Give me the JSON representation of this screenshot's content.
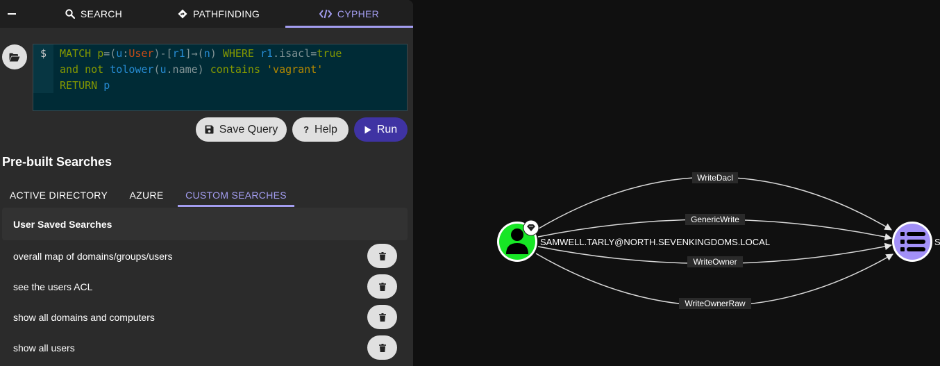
{
  "tabs": [
    {
      "label": "SEARCH",
      "icon": "search-icon",
      "active": false
    },
    {
      "label": "PATHFINDING",
      "icon": "pathfinding-icon",
      "active": false
    },
    {
      "label": "CYPHER",
      "icon": "code-icon",
      "active": true
    }
  ],
  "editor": {
    "prompt": "$",
    "query": "MATCH p=(u:User)-[r1]→(n) WHERE r1.isacl=true and not tolower(u.name) contains 'vagrant' RETURN p"
  },
  "actions": {
    "save_label": "Save Query",
    "help_label": "Help",
    "run_label": "Run",
    "help_glyph": "?"
  },
  "prebuilt": {
    "title": "Pre-built Searches",
    "tabs": [
      "ACTIVE DIRECTORY",
      "AZURE",
      "CUSTOM SEARCHES"
    ],
    "active_tab": "CUSTOM SEARCHES",
    "saved_header": "User Saved Searches",
    "items": [
      "overall map of domains/groups/users",
      "see the users ACL",
      "show all domains and computers",
      "show all users"
    ]
  },
  "graph": {
    "source_node": {
      "label": "SAMWELL.TARLY@NORTH.SEVENKINGDOMS.LOCAL",
      "type": "user",
      "color": "#17e625"
    },
    "target_node": {
      "label": "S",
      "type": "list",
      "color": "#a290f8"
    },
    "edges": [
      "WriteDacl",
      "GenericWrite",
      "WriteOwner",
      "WriteOwnerRaw"
    ]
  },
  "colors": {
    "accent": "#a39df0",
    "run_button": "#3f33a3",
    "editor_bg": "#002b36"
  }
}
